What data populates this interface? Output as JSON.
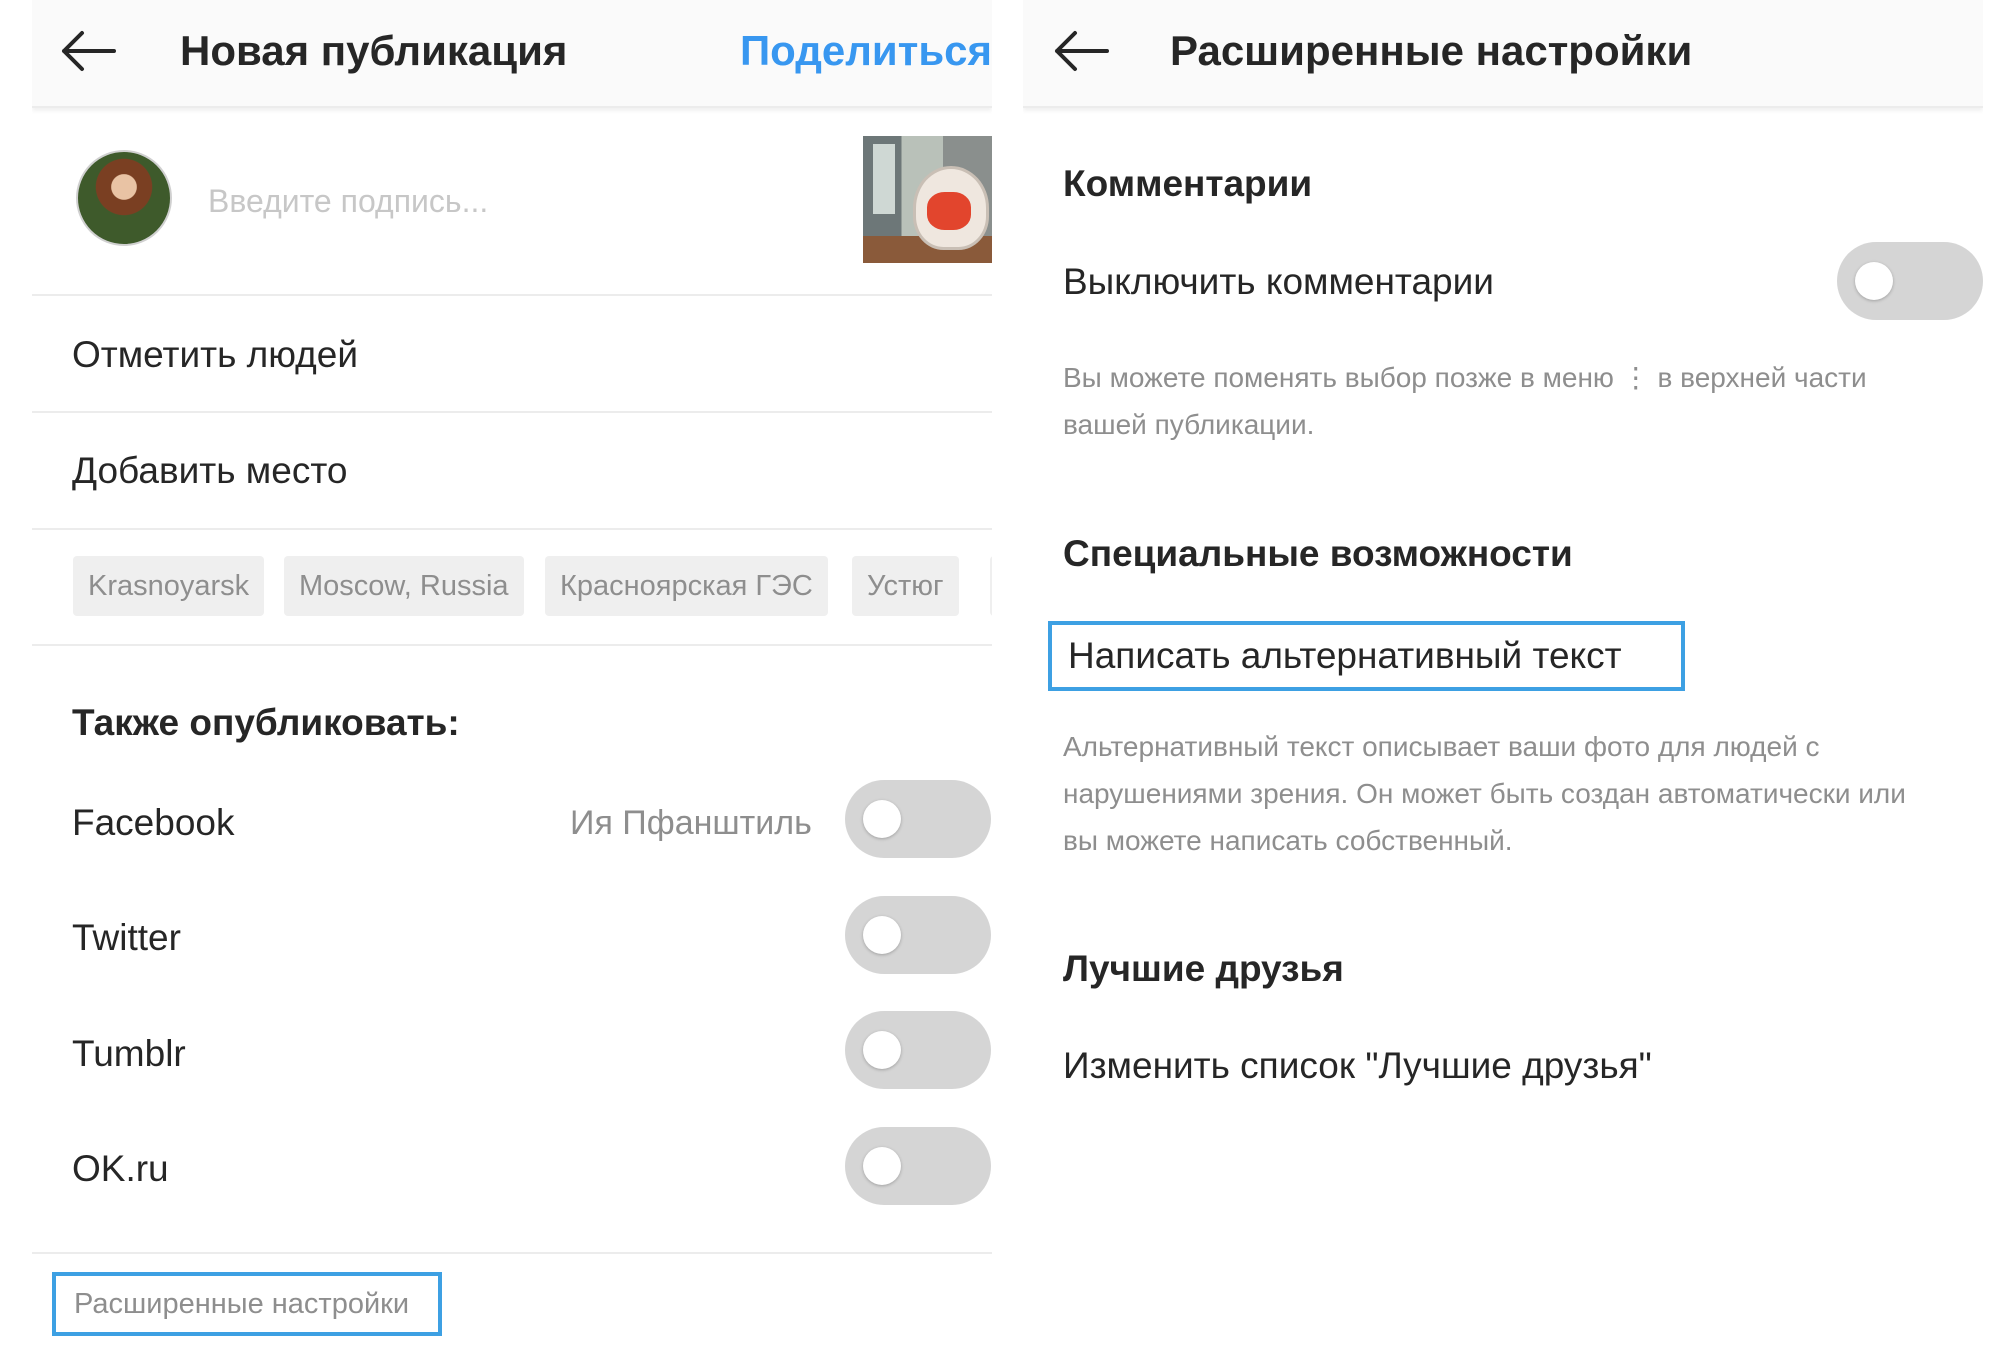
{
  "left_panel": {
    "header": {
      "title": "Новая публикация",
      "share_label": "Поделиться"
    },
    "caption": {
      "placeholder": "Введите подпись..."
    },
    "tag_people_label": "Отметить людей",
    "add_location_label": "Добавить место",
    "location_suggestions": [
      "Krasnoyarsk",
      "Moscow, Russia",
      "Красноярская ГЭС",
      "Устюг"
    ],
    "also_share": {
      "title": "Также опубликовать:",
      "networks": [
        {
          "label": "Facebook",
          "account": "Ия Пфанштиль",
          "enabled": false
        },
        {
          "label": "Twitter",
          "enabled": false
        },
        {
          "label": "Tumblr",
          "enabled": false
        },
        {
          "label": "OK.ru",
          "enabled": false
        }
      ]
    },
    "advanced_settings_label": "Расширенные настройки"
  },
  "right_panel": {
    "header": {
      "title": "Расширенные настройки"
    },
    "comments": {
      "title": "Комментарии",
      "toggle_label": "Выключить комментарии",
      "toggle_enabled": false,
      "note_line1": "Вы можете поменять выбор позже в меню ⋮ в верхней части",
      "note_line2": "вашей публикации."
    },
    "accessibility": {
      "title": "Специальные возможности",
      "alt_text_label": "Написать альтернативный текст",
      "note_line1": "Альтернативный текст описывает ваши фото для людей с",
      "note_line2": "нарушениями зрения. Он может быть создан автоматически или",
      "note_line3": "вы можете написать собственный."
    },
    "close_friends": {
      "title": "Лучшие друзья",
      "edit_label": "Изменить список \"Лучшие друзья\""
    }
  },
  "colors": {
    "accent": "#3897f0",
    "highlight_border": "#3da0e3",
    "switch_off": "#d5d5d5",
    "muted_text": "#8e8e8e"
  }
}
